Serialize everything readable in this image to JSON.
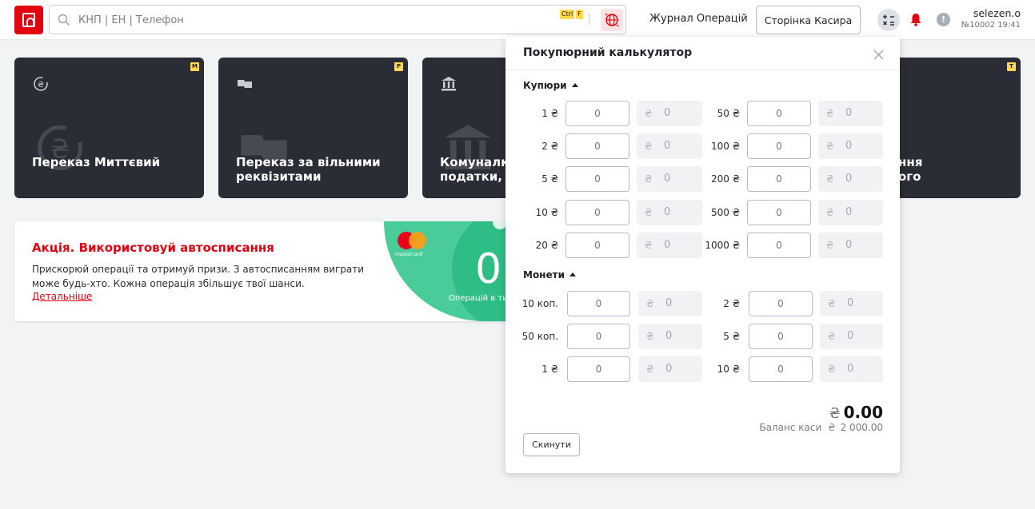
{
  "header": {
    "search_placeholder": "КНП | ЕН | Телефон",
    "shortcut_ctrl": "Ctrl",
    "shortcut_key": "F",
    "journal_link": "Журнал Операцій",
    "cashier_button": "Сторінка Касира",
    "user_name": "selezen.o",
    "user_meta": "№10002 19:41",
    "alert_glyph": "!"
  },
  "tiles": [
    {
      "title_line1": "Переказ Миттєвий",
      "title_line2": "",
      "hotkey": "M",
      "icon": "currency-exchange-icon"
    },
    {
      "title_line1": "Переказ за вільними",
      "title_line2": "реквізитами",
      "hotkey": "P",
      "icon": "open-book-icon"
    },
    {
      "title_line1": "Комуналка",
      "title_line2": "податки, та",
      "hotkey": "",
      "icon": "bank-icon"
    },
    {
      "title_line1": "ння",
      "title_line2": "ого",
      "hotkey": "T",
      "icon": "document-icon"
    }
  ],
  "promo": {
    "title": "Акція. Використовуй автосписання",
    "description": "Прискорюй операції та отримуй призи. З автосписанням виграти може будь-хто. Кожна операція збільшує твої шанси.",
    "link": "Детальніше",
    "card_brand": "mastercard",
    "counter_value": "0",
    "counter_label": "Операцій в ти"
  },
  "calculator": {
    "title": "Покупюрний калькулятор",
    "currency_symbol": "₴",
    "banknotes_label": "Купюри",
    "coins_label": "Монети",
    "banknotes": [
      {
        "denomination": "1 ₴",
        "qty": "",
        "qty_placeholder": "0",
        "sum": "0"
      },
      {
        "denomination": "50 ₴",
        "qty": "",
        "qty_placeholder": "0",
        "sum": "0"
      },
      {
        "denomination": "2 ₴",
        "qty": "",
        "qty_placeholder": "0",
        "sum": "0"
      },
      {
        "denomination": "100 ₴",
        "qty": "",
        "qty_placeholder": "0",
        "sum": "0"
      },
      {
        "denomination": "5 ₴",
        "qty": "",
        "qty_placeholder": "0",
        "sum": "0"
      },
      {
        "denomination": "200 ₴",
        "qty": "",
        "qty_placeholder": "0",
        "sum": "0"
      },
      {
        "denomination": "10 ₴",
        "qty": "",
        "qty_placeholder": "0",
        "sum": "0"
      },
      {
        "denomination": "500 ₴",
        "qty": "",
        "qty_placeholder": "0",
        "sum": "0"
      },
      {
        "denomination": "20 ₴",
        "qty": "",
        "qty_placeholder": "0",
        "sum": "0"
      },
      {
        "denomination": "1000 ₴",
        "qty": "",
        "qty_placeholder": "0",
        "sum": "0"
      }
    ],
    "coins": [
      {
        "denomination": "10 коп.",
        "qty": "",
        "qty_placeholder": "0",
        "sum": "0"
      },
      {
        "denomination": "2 ₴",
        "qty": "",
        "qty_placeholder": "0",
        "sum": "0"
      },
      {
        "denomination": "50 коп.",
        "qty": "",
        "qty_placeholder": "0",
        "sum": "0"
      },
      {
        "denomination": "5 ₴",
        "qty": "",
        "qty_placeholder": "0",
        "sum": "0"
      },
      {
        "denomination": "1 ₴",
        "qty": "",
        "qty_placeholder": "0",
        "sum": "0"
      },
      {
        "denomination": "10 ₴",
        "qty": "",
        "qty_placeholder": "0",
        "sum": "0"
      }
    ],
    "total": "0.00",
    "balance_label": "Баланс каси",
    "balance_value": "2 000.00",
    "reset_button": "Скинути"
  },
  "colors": {
    "brand": "#e3000f",
    "tile_bg": "#2b2d36",
    "promo_green": "#49cc9a",
    "hotkey_badge": "#ffd84d"
  }
}
